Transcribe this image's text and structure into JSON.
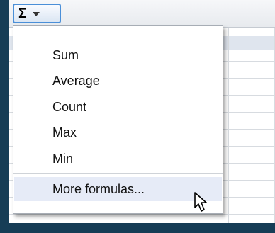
{
  "toolbar": {
    "sum_symbol": "Σ",
    "dropdown_icon": "chevron-down-icon"
  },
  "menu": {
    "items": [
      {
        "label": "Sum"
      },
      {
        "label": "Average"
      },
      {
        "label": "Count"
      },
      {
        "label": "Max"
      },
      {
        "label": "Min"
      },
      {
        "label": "More formulas..."
      }
    ],
    "highlighted_item": "More formulas..."
  },
  "colors": {
    "background": "#163d56",
    "button_border": "#4a8fd8",
    "highlight": "#e6ebf7"
  },
  "cursor": {
    "icon": "mouse-pointer-icon"
  }
}
